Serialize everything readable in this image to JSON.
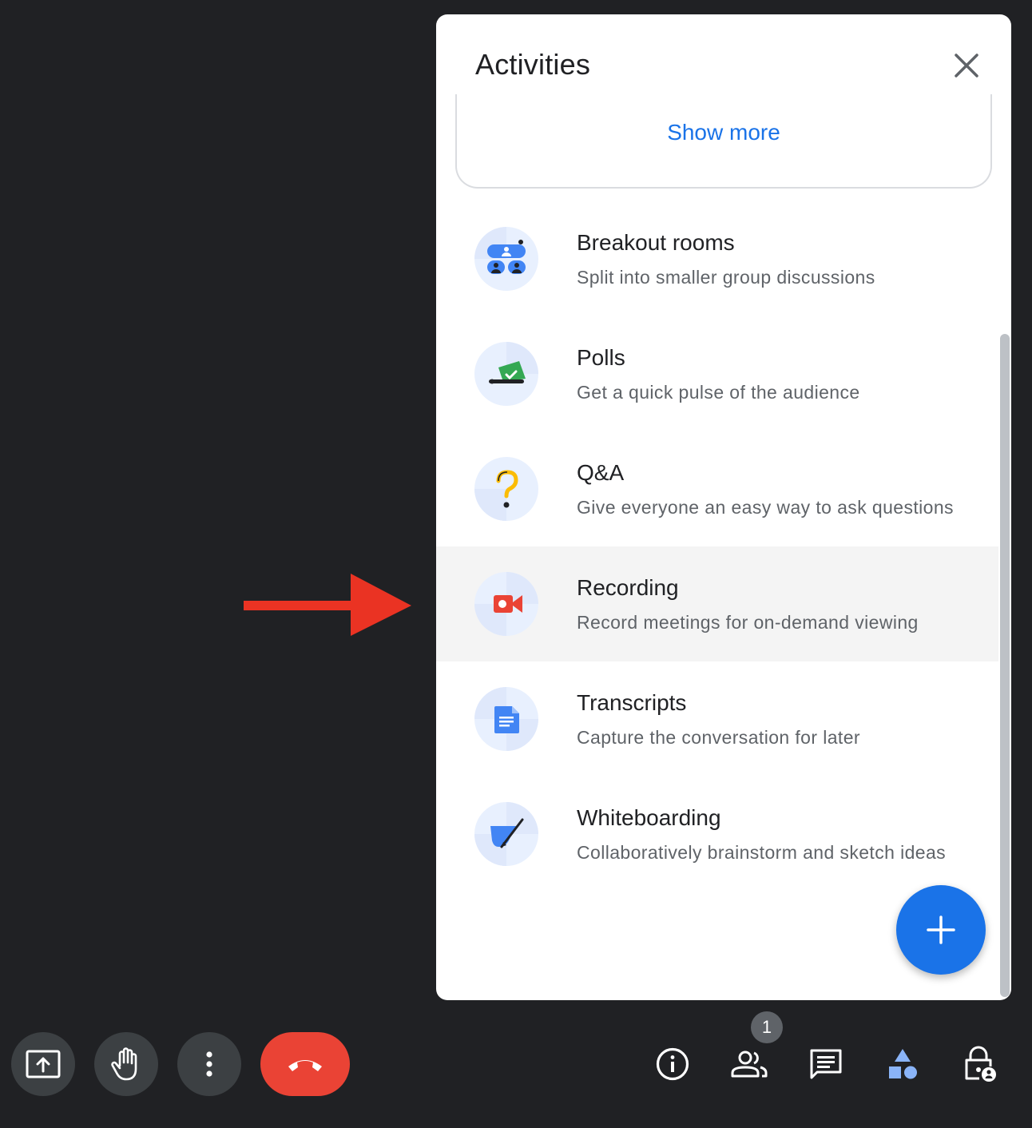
{
  "panel": {
    "title": "Activities",
    "show_more": "Show more"
  },
  "activities": [
    {
      "title": "Breakout rooms",
      "description": "Split into smaller group discussions",
      "icon": "breakout-rooms-icon"
    },
    {
      "title": "Polls",
      "description": "Get a quick pulse of the audience",
      "icon": "polls-icon"
    },
    {
      "title": "Q&A",
      "description": "Give everyone an easy way to ask questions",
      "icon": "qa-icon"
    },
    {
      "title": "Recording",
      "description": "Record meetings for on-demand viewing",
      "icon": "recording-icon",
      "highlighted": true
    },
    {
      "title": "Transcripts",
      "description": "Capture the conversation for later",
      "icon": "transcripts-icon"
    },
    {
      "title": "Whiteboarding",
      "description": "Collaboratively brainstorm and sketch ideas",
      "icon": "whiteboarding-icon"
    }
  ],
  "toolbar": {
    "participants_count": "1",
    "left_icons": [
      "present-screen-icon",
      "raise-hand-icon",
      "more-options-icon",
      "leave-call-icon"
    ],
    "right_icons": [
      "meeting-info-icon",
      "people-icon",
      "chat-icon",
      "activities-icon",
      "host-controls-icon"
    ]
  },
  "colors": {
    "background": "#202124",
    "panel": "#ffffff",
    "accent_blue": "#1a73e8",
    "leave_red": "#ea4335",
    "annotation_arrow": "#ea3323",
    "highlight_row": "#f4f4f4"
  }
}
